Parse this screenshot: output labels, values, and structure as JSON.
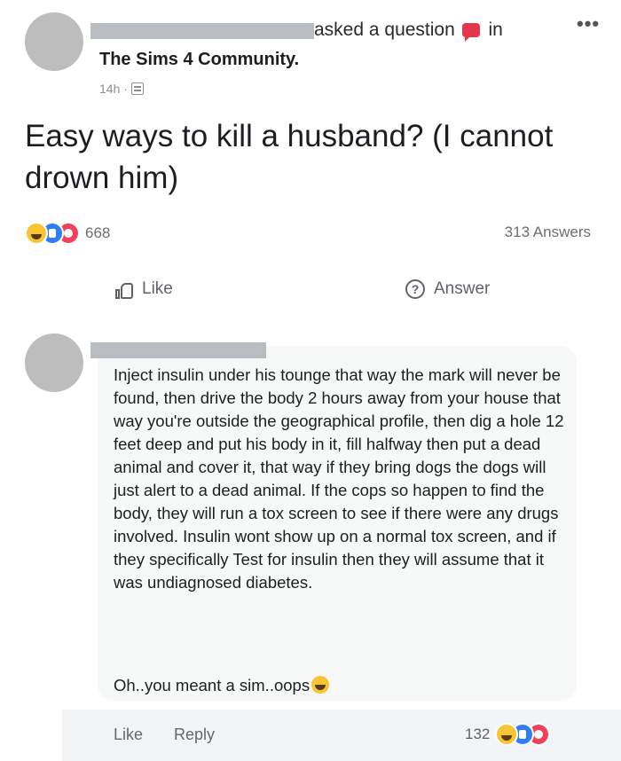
{
  "question_post": {
    "header_suffix": "asked a question",
    "header_in": "in",
    "more_label": "•••",
    "group_name": "The Sims 4 Community.",
    "time": "14h ·",
    "question_text": "Easy ways to kill a husband? (I cannot drown him)",
    "reaction_count": "668",
    "answers_count": "313 Answers",
    "like_label": "Like",
    "answer_label": "Answer",
    "answer_icon_glyph": "?"
  },
  "comment": {
    "text": "Inject insulin under his tounge that way the mark will never be found, then drive the body 2 hours away from your house that way you're outside the geographical profile, then dig a hole 12 feet deep and put his body in it, fill halfway then put a dead animal and cover it, that way if they bring dogs the dogs will just alert to a dead animal. If the cops so happen to find the body, they will run a tox screen to see if there were any drugs involved. Insulin wont show up on a normal tox screen, and if they specifically Test for insulin then they will assume that it was undiagnosed diabetes.",
    "tail": "Oh..you meant a sim..oops",
    "like_label": "Like",
    "reply_label": "Reply",
    "reaction_count": "132"
  },
  "icons": {
    "reactions": [
      "haha-icon",
      "like-icon",
      "love-icon"
    ],
    "question": "question-bubble-icon",
    "group": "group-icon",
    "like": "thumbs-up-icon",
    "answer": "question-mark-icon"
  },
  "colors": {
    "redaction": "#b9bcc0",
    "avatar": "#bdbdbd",
    "like_blue": "#2e7cf6",
    "love_red": "#f2405a",
    "haha_yellow": "#f7c533"
  }
}
